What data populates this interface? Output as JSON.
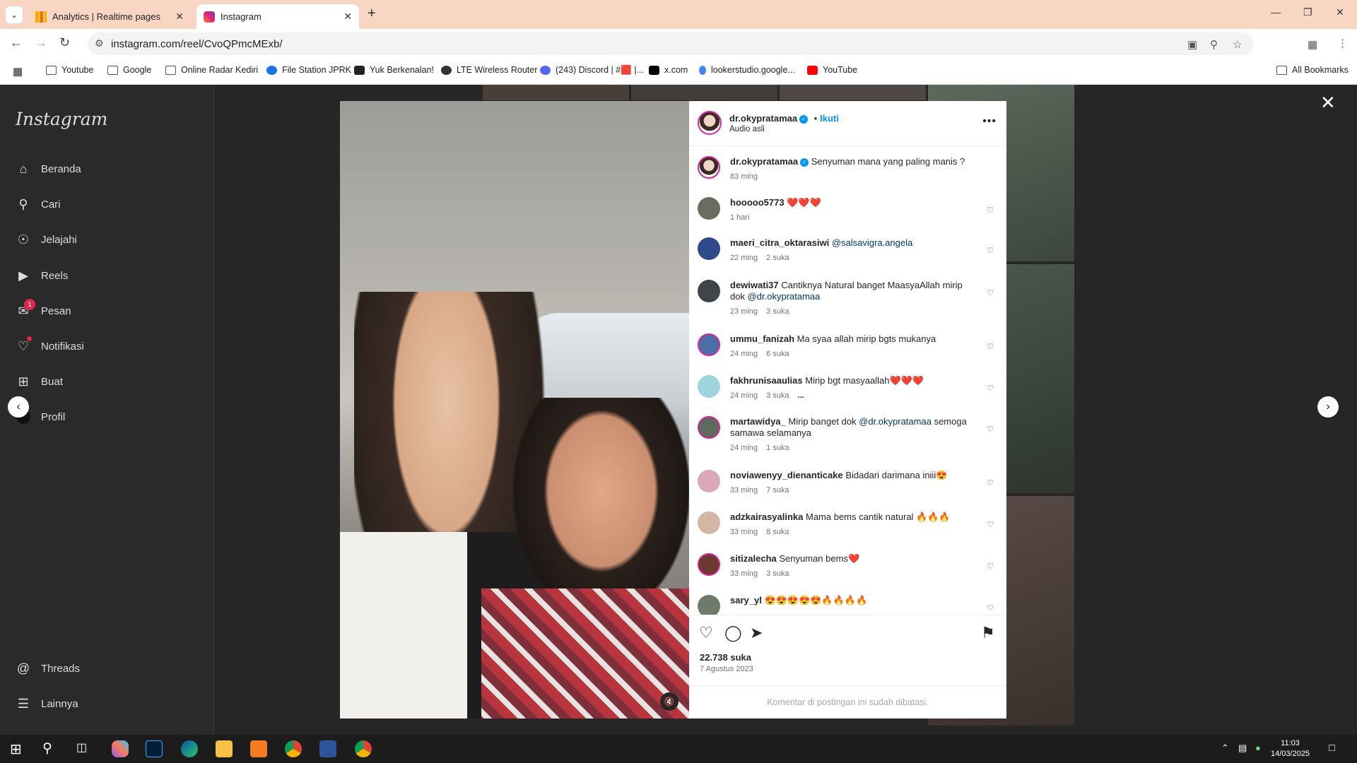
{
  "browser": {
    "tabs": [
      {
        "title": "Analytics | Realtime pages",
        "active": false,
        "favicon_color": "#f9ab00"
      },
      {
        "title": "Instagram",
        "active": true,
        "favicon_color": "#d6249f"
      }
    ],
    "url": "instagram.com/reel/CvoQPmcMExb/",
    "bookmarks": [
      {
        "label": "Youtube",
        "icon": "folder-icon"
      },
      {
        "label": "Google",
        "icon": "folder-icon"
      },
      {
        "label": "Online Radar Kediri",
        "icon": "folder-icon"
      },
      {
        "label": "File Station JPRK",
        "icon": "file-station-icon"
      },
      {
        "label": "Yuk Berkenalan!",
        "icon": "site-icon"
      },
      {
        "label": "LTE Wireless Router",
        "icon": "globe-icon"
      },
      {
        "label": "(243) Discord | #🟥 |...",
        "icon": "discord-icon"
      },
      {
        "label": "x.com",
        "icon": "x-icon"
      },
      {
        "label": "lookerstudio.google...",
        "icon": "lookerstudio-icon"
      },
      {
        "label": "YouTube",
        "icon": "youtube-icon"
      }
    ],
    "all_bookmarks": "All Bookmarks"
  },
  "sidebar": {
    "logo": "Instagram",
    "items": [
      {
        "label": "Beranda",
        "icon": "home-icon"
      },
      {
        "label": "Cari",
        "icon": "search-icon"
      },
      {
        "label": "Jelajahi",
        "icon": "compass-icon"
      },
      {
        "label": "Reels",
        "icon": "reels-icon"
      },
      {
        "label": "Pesan",
        "icon": "messenger-icon",
        "badge": "1"
      },
      {
        "label": "Notifikasi",
        "icon": "heart-icon"
      },
      {
        "label": "Buat",
        "icon": "plus-square-icon"
      },
      {
        "label": "Profil",
        "icon": "avatar-icon"
      }
    ],
    "bottom_items": [
      {
        "label": "Threads",
        "icon": "threads-icon"
      },
      {
        "label": "Lainnya",
        "icon": "menu-icon"
      }
    ]
  },
  "post": {
    "author": "dr.okypratamaa",
    "follow_label": "Ikuti",
    "audio": "Audio asli",
    "caption": {
      "user": "dr.okypratamaa",
      "text": "Senyuman mana yang paling manis ?",
      "time": "83 ming"
    },
    "comments": [
      {
        "user": "hooooo5773",
        "text": "❤️❤️❤️",
        "time": "1 hari",
        "likes": ""
      },
      {
        "user": "maeri_citra_oktarasiwi",
        "text": "",
        "mention": "@salsavigra.angela",
        "tail": "",
        "time": "22 ming",
        "likes": "2 suka"
      },
      {
        "user": "dewiwati37",
        "text": "Cantiknya Natural banget MaasyaAllah mirip dok",
        "mention": "@dr.okypratamaa",
        "tail": "",
        "time": "23 ming",
        "likes": "3 suka"
      },
      {
        "user": "ummu_fanizah",
        "text": "Ma syaa allah mirip bgts mukanya",
        "time": "24 ming",
        "likes": "6 suka"
      },
      {
        "user": "fakhrunisaaulias",
        "text": "Mirip bgt masyaallah❤️❤️❤️",
        "time": "24 ming",
        "likes": "3 suka",
        "more": "..."
      },
      {
        "user": "martawidya_",
        "text": "Mirip banget dok",
        "mention": "@dr.okypratamaa",
        "tail": "semoga samawa selamanya",
        "time": "24 ming",
        "likes": "1 suka"
      },
      {
        "user": "noviawenyy_dienanticake",
        "text": "Bidadari darimana iniii😍",
        "time": "33 ming",
        "likes": "7 suka"
      },
      {
        "user": "adzkairasyalinka",
        "text": "Mama bems cantik natural 🔥🔥🔥",
        "time": "33 ming",
        "likes": "8 suka"
      },
      {
        "user": "sitizalecha",
        "text": "Senyuman bems❤️",
        "time": "33 ming",
        "likes": "3 suka"
      },
      {
        "user": "sary_yl",
        "text": "😍😍😍😍😍🔥🔥🔥🔥",
        "time": "",
        "likes": ""
      }
    ],
    "likes_count": "22.738 suka",
    "date": "7 Agustus 2023",
    "comments_limited": "Komentar di postingan ini sudah dibatasi."
  },
  "taskbar": {
    "time": "11:03",
    "date": "14/03/2025"
  },
  "colors": {
    "tabbar_bg": "#f9d6c4",
    "accent_blue": "#0095f6",
    "badge_red": "#e0264a"
  }
}
